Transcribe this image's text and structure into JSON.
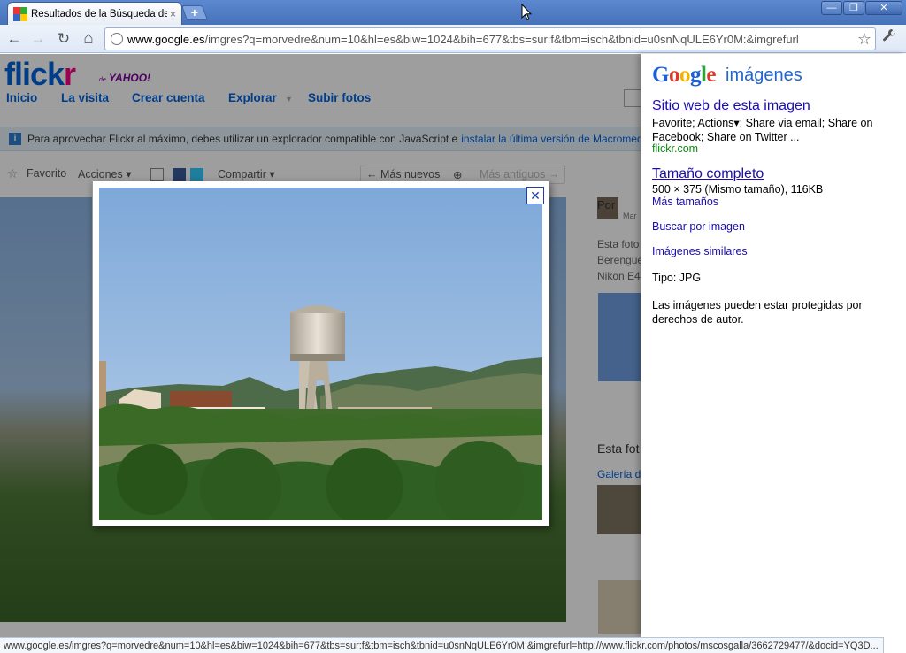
{
  "browser": {
    "tab_title": "Resultados de la Búsqueda de",
    "tab_close": "×",
    "new_tab": "+",
    "window_buttons": {
      "minimize": "—",
      "restore": "❐",
      "close": "✕"
    },
    "nav": {
      "back": "←",
      "forward": "→",
      "reload": "↻",
      "home": "⌂"
    },
    "url_host": "www.google.es",
    "url_rest": "/imgres?q=morvedre&num=10&hl=es&biw=1024&bih=677&tbs=sur:f&tbm=isch&tbnid=u0snNqULE6Yr0M:&imgrefurl",
    "star": "☆",
    "wrench": "🔧"
  },
  "flickr": {
    "logo_part1": "flick",
    "logo_part2": "r",
    "logo_sub_small": "de",
    "logo_sub": "YAHOO!",
    "nav": [
      "Inicio",
      "La visita",
      "Crear cuenta",
      "Explorar",
      "Subir fotos"
    ],
    "info_message": "Para aprovechar Flickr al máximo, debes utilizar un explorador compatible con JavaScript e",
    "info_link": "instalar la última versión de Macromedia Flash Player.",
    "actions": {
      "favorite": "Favorito",
      "actions": "Acciones ▾",
      "share": "Compartir ▾",
      "newer": "← Más nuevos",
      "older": "Más antiguos →"
    },
    "side_texts": {
      "author": "Por",
      "author_sub": "Mar",
      "desc1": "Esta foto",
      "desc2": "Berengue",
      "desc3": "Nikon E4",
      "this_photo": "Esta fot",
      "gallery": "Galería d"
    }
  },
  "lightbox": {
    "close_label": "✕"
  },
  "panel": {
    "logo": [
      "G",
      "o",
      "o",
      "g",
      "l",
      "e"
    ],
    "logo_sub": "imágenes",
    "site_link": "Sitio web de esta imagen",
    "site_desc": "Favorite; Actions▾; Share via email; Share on Facebook; Share on Twitter ...",
    "site_domain": "flickr.com",
    "full_size": "Tamaño completo",
    "size_info": "500 × 375 (Mismo tamaño), 116KB",
    "more_sizes": "Más tamaños",
    "search_by_image": "Buscar por imagen",
    "similar_images": "Imágenes similares",
    "type_label": "Tipo:  JPG",
    "copyright": "Las imágenes pueden estar protegidas por derechos de autor."
  },
  "status_url": "www.google.es/imgres?q=morvedre&num=10&hl=es&biw=1024&bih=677&tbs=sur:f&tbm=isch&tbnid=u0snNqULE6Yr0M:&imgrefurl=http://www.flickr.com/photos/mscosgalla/3662729477/&docid=YQ3D..."
}
